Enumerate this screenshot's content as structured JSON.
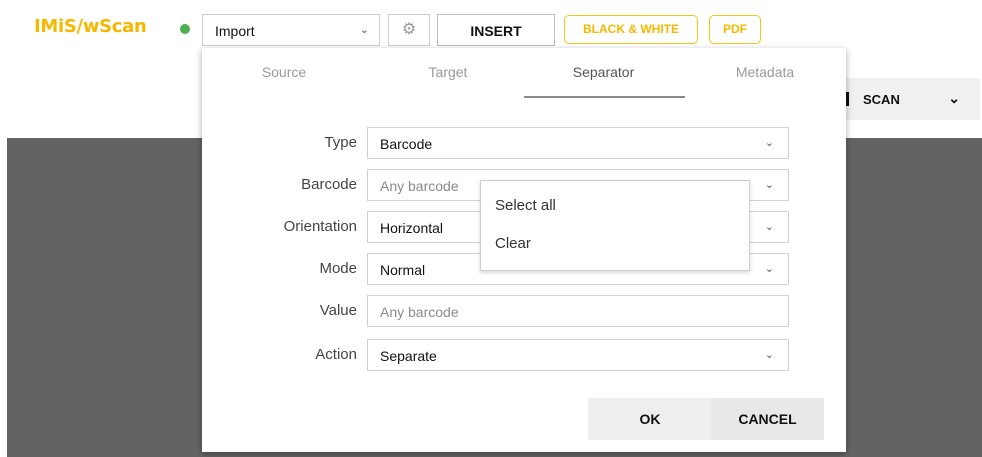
{
  "app": {
    "title": "IMiS/wScan",
    "status_color": "#4caf50",
    "brand_color": "#f5b800"
  },
  "toolbar": {
    "mode_select": {
      "value": "Import",
      "icon": "chevron-down-icon"
    },
    "settings_icon": "gear-icon",
    "insert_label": "INSERT",
    "bw_label": "BLACK & WHITE",
    "pdf_label": "PDF"
  },
  "scan": {
    "label": "SCAN",
    "icon": "chevron-down-icon"
  },
  "dialog": {
    "tabs": [
      {
        "label": "Source",
        "active": false
      },
      {
        "label": "Target",
        "active": false
      },
      {
        "label": "Separator",
        "active": true
      },
      {
        "label": "Metadata",
        "active": false
      }
    ],
    "fields": {
      "type": {
        "label": "Type",
        "value": "Barcode"
      },
      "barcode": {
        "label": "Barcode",
        "placeholder": "Any barcode"
      },
      "orientation": {
        "label": "Orientation",
        "value": "Horizontal"
      },
      "mode": {
        "label": "Mode",
        "value": "Normal"
      },
      "value": {
        "label": "Value",
        "placeholder": "Any barcode"
      },
      "action": {
        "label": "Action",
        "value": "Separate"
      }
    },
    "barcode_menu": {
      "items": [
        "Select all",
        "Clear"
      ]
    },
    "ok_label": "OK",
    "cancel_label": "CANCEL"
  },
  "colors": {
    "accent": "#f5c518",
    "backdrop": "#636363"
  }
}
